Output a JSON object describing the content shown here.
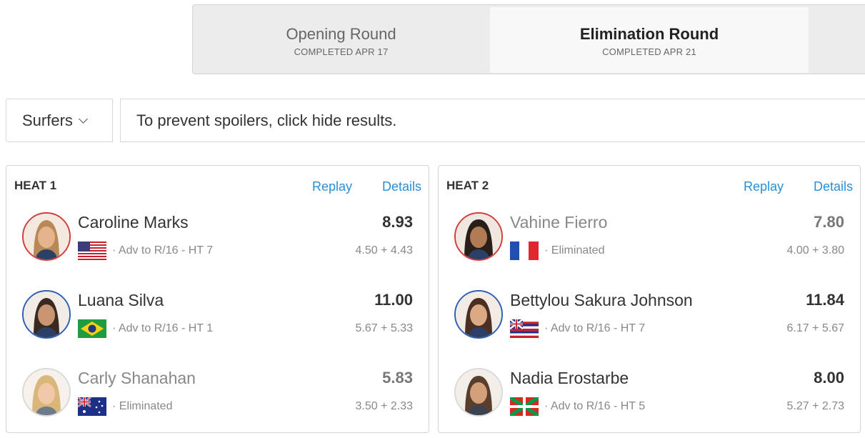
{
  "rounds": [
    {
      "title": "Opening Round",
      "status": "COMPLETED APR 17"
    },
    {
      "title": "Elimination Round",
      "status": "COMPLETED APR 21"
    }
  ],
  "filter": {
    "label": "Surfers"
  },
  "notice": "To prevent spoilers, click hide results.",
  "heats": [
    {
      "title": "HEAT 1",
      "replay": "Replay",
      "details": "Details",
      "surfers": [
        {
          "name": "Caroline Marks",
          "total": "8.93",
          "status": "· Adv to R/16 - HT 7",
          "waves": "4.50 + 4.43",
          "flag": "usa-flag-icon"
        },
        {
          "name": "Luana Silva",
          "total": "11.00",
          "status": "· Adv to R/16 - HT 1",
          "waves": "5.67 + 5.33",
          "flag": "brazil-flag-icon"
        },
        {
          "name": "Carly Shanahan",
          "total": "5.83",
          "status": "· Eliminated",
          "waves": "3.50 + 2.33",
          "flag": "australia-flag-icon"
        }
      ]
    },
    {
      "title": "HEAT 2",
      "replay": "Replay",
      "details": "Details",
      "surfers": [
        {
          "name": "Vahine Fierro",
          "total": "7.80",
          "status": "· Eliminated",
          "waves": "4.00 + 3.80",
          "flag": "france-flag-icon"
        },
        {
          "name": "Bettylou Sakura Johnson",
          "total": "11.84",
          "status": "· Adv to R/16 - HT 7",
          "waves": "6.17 + 5.67",
          "flag": "hawaii-flag-icon"
        },
        {
          "name": "Nadia Erostarbe",
          "total": "8.00",
          "status": "· Adv to R/16 - HT 5",
          "waves": "5.27 + 2.73",
          "flag": "basque-flag-icon"
        }
      ]
    }
  ],
  "colors": {
    "link": "#2a8fd8",
    "jersey_red": "#d63b3b",
    "jersey_blue": "#2d5fb8"
  }
}
